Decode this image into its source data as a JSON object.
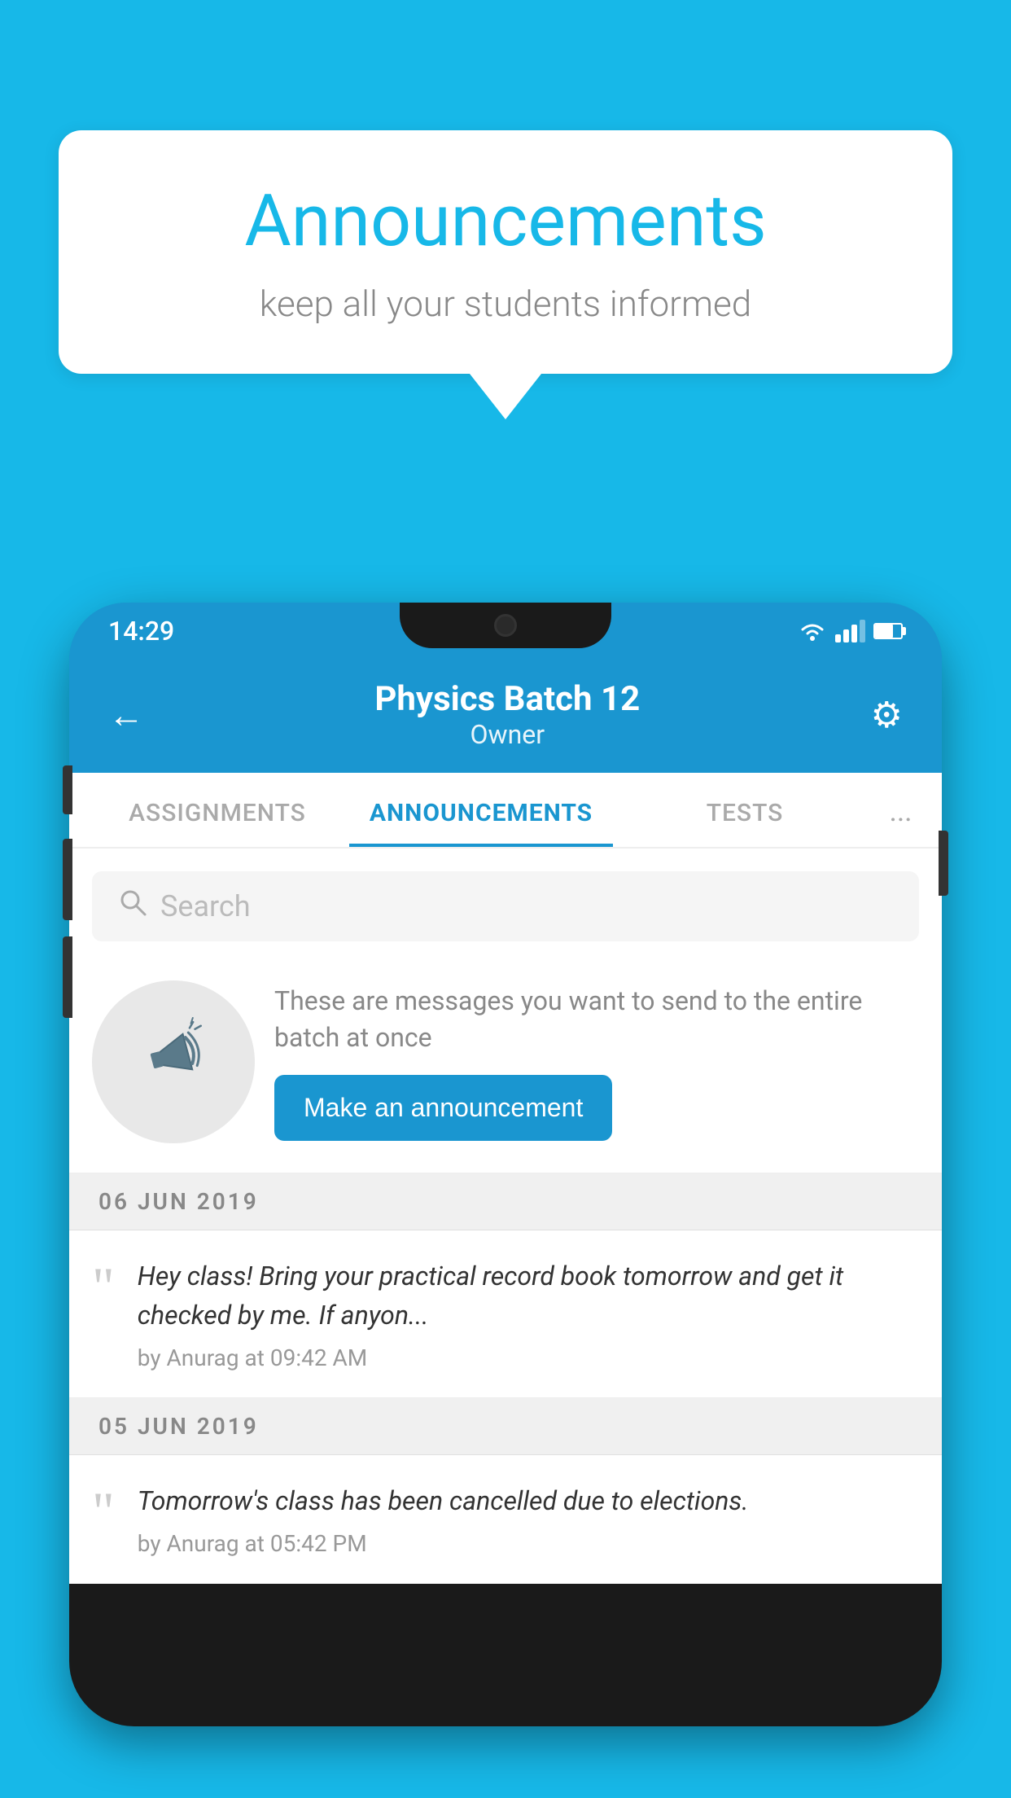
{
  "background_color": "#17b8e8",
  "speech_bubble": {
    "title": "Announcements",
    "subtitle": "keep all your students informed"
  },
  "phone": {
    "status_bar": {
      "time": "14:29"
    },
    "header": {
      "title": "Physics Batch 12",
      "subtitle": "Owner",
      "back_label": "←",
      "settings_label": "⚙"
    },
    "tabs": [
      {
        "label": "ASSIGNMENTS",
        "active": false
      },
      {
        "label": "ANNOUNCEMENTS",
        "active": true
      },
      {
        "label": "TESTS",
        "active": false
      },
      {
        "label": "...",
        "active": false
      }
    ],
    "search": {
      "placeholder": "Search"
    },
    "promo": {
      "description": "These are messages you want to send to the entire batch at once",
      "button_label": "Make an announcement"
    },
    "announcements": [
      {
        "date": "06  JUN  2019",
        "text": "Hey class! Bring your practical record book tomorrow and get it checked by me. If anyon...",
        "meta": "by Anurag at 09:42 AM"
      },
      {
        "date": "05  JUN  2019",
        "text": "Tomorrow's class has been cancelled due to elections.",
        "meta": "by Anurag at 05:42 PM"
      }
    ]
  }
}
